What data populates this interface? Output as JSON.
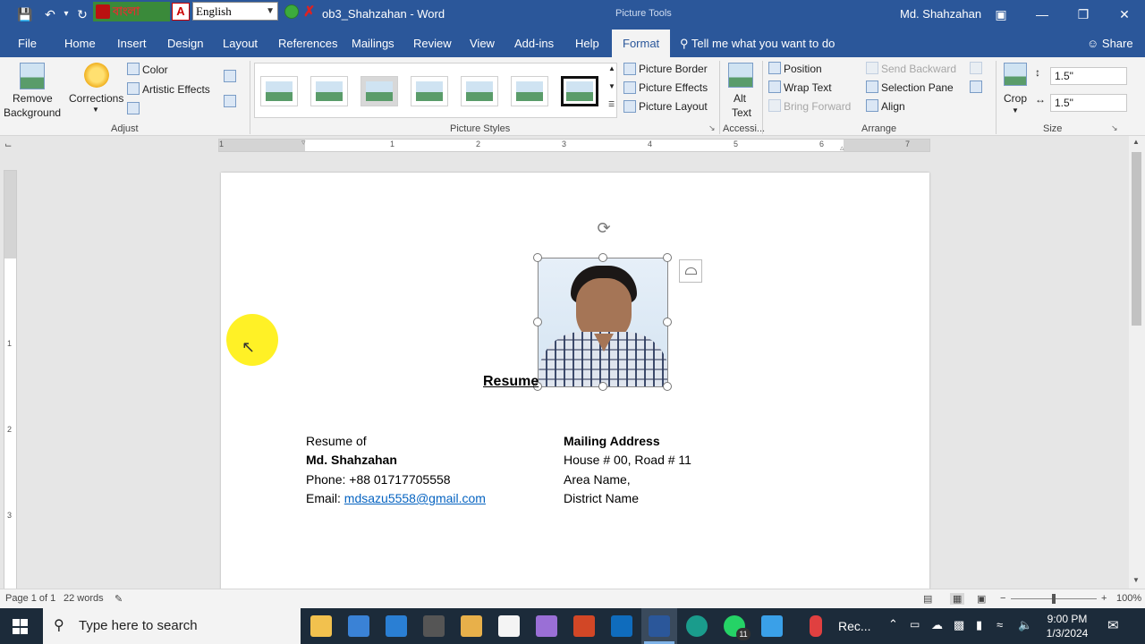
{
  "titlebar": {
    "bangla_label": "বাংলা",
    "language": "English",
    "doc_title": "ob3_Shahzahan  -  Word",
    "tools_label": "Picture Tools",
    "user": "Md. Shahzahan",
    "controls": [
      "ribbon-display-icon",
      "minimize-icon",
      "restore-icon",
      "close-icon"
    ]
  },
  "tabs": [
    "File",
    "Home",
    "Insert",
    "Design",
    "Layout",
    "References",
    "Mailings",
    "Review",
    "View",
    "Add-ins",
    "Help",
    "Format"
  ],
  "active_tab": "Format",
  "tellme": "Tell me what you want to do",
  "share": "Share",
  "ribbon": {
    "remove_bg_1": "Remove",
    "remove_bg_2": "Background",
    "corrections": "Corrections",
    "color": "Color",
    "artistic": "Artistic Effects",
    "adjust_label": "Adjust",
    "styles_label": "Picture Styles",
    "border": "Picture Border",
    "effects": "Picture Effects",
    "layout": "Picture Layout",
    "alt_1": "Alt",
    "alt_2": "Text",
    "access_label": "Accessi...",
    "position": "Position",
    "wrap": "Wrap Text",
    "bring_forward": "Bring Forward",
    "send_backward": "Send Backward",
    "selection_pane": "Selection Pane",
    "align": "Align",
    "arrange_label": "Arrange",
    "crop": "Crop",
    "height": "1.5\"",
    "width": "1.5\"",
    "size_label": "Size"
  },
  "ruler": [
    "1",
    "1",
    "2",
    "3",
    "4",
    "5",
    "6",
    "7"
  ],
  "vruler": [
    "1",
    "2",
    "3"
  ],
  "document": {
    "title": "Resume",
    "left_col": {
      "line1": "Resume of",
      "name": "Md. Shahzahan",
      "phone": "Phone: +88 01717705558",
      "email_label": "Email: ",
      "email": "mdsazu5558@gmail.com"
    },
    "right_col": {
      "heading": "Mailing Address",
      "line1": "House # 00, Road # 11",
      "line2": "Area Name,",
      "line3": "District Name"
    }
  },
  "status": {
    "page": "Page 1 of 1",
    "words": "22 words",
    "zoom": "100%"
  },
  "taskbar": {
    "search_placeholder": "Type here to search",
    "rec_label": "Rec...",
    "whatsapp_badge": "11",
    "time": "9:00 PM",
    "date": "1/3/2024"
  }
}
